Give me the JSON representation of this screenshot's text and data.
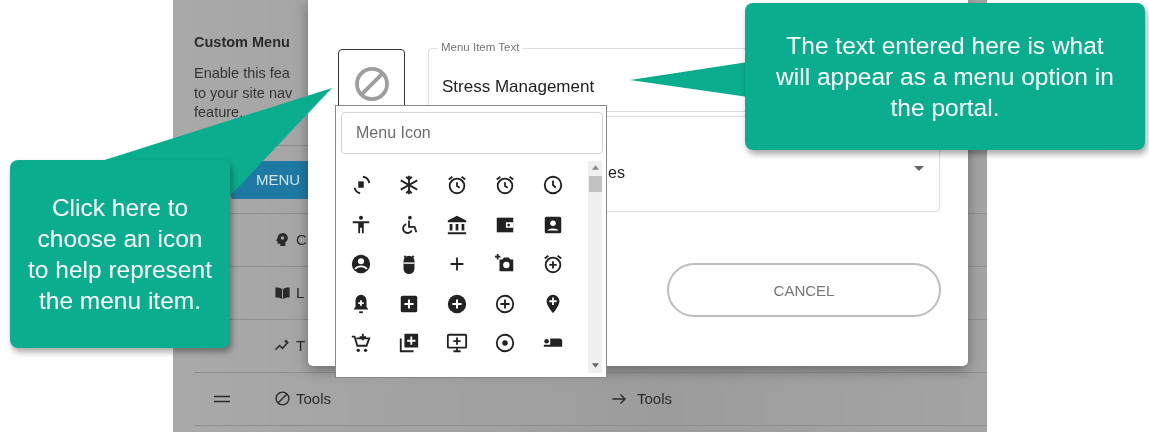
{
  "page": {
    "title": "Custom Menu",
    "description_lines": [
      "Enable this fea",
      "to your site nav",
      "feature."
    ],
    "menu_button": "MENU",
    "rows": [
      {
        "label": "C"
      },
      {
        "label": "L"
      },
      {
        "label": "T"
      },
      {
        "label": "Tools",
        "handle": true,
        "target": "Tools"
      }
    ]
  },
  "dialog": {
    "text_field": {
      "label": "Menu Item Text",
      "value": "Stress Management"
    },
    "select": {
      "value": "es"
    },
    "cancel_button": "CANCEL"
  },
  "icon_picker": {
    "placeholder": "Menu Icon"
  },
  "callouts": [
    {
      "text": "The text entered here is what will appear as a menu option in the portal."
    },
    {
      "text": "Click here to choose an icon to help represent the menu item."
    }
  ]
}
